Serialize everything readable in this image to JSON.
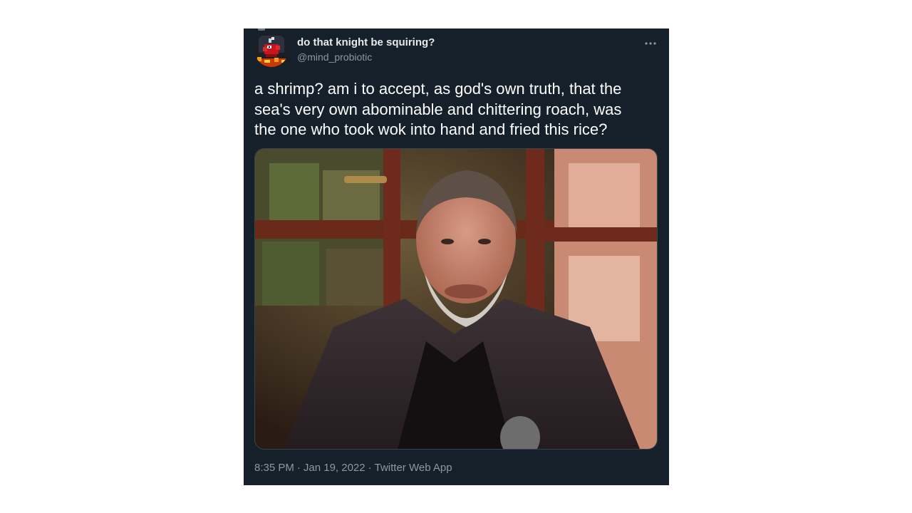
{
  "tweet": {
    "author": {
      "display_name": "do that knight be squiring?",
      "handle": "@mind_probiotic",
      "avatar_icon": "pixel-knight-avatar"
    },
    "more_icon": "more-dots-icon",
    "text": "a shrimp? am i to accept, as god's own truth, that the\nsea's very own abominable and chittering roach, was\nthe one who took wok into hand and fried this rice?",
    "media": {
      "kind": "photo"
    },
    "meta": {
      "time": "8:35 PM",
      "separator": "·",
      "date": "Jan 19, 2022",
      "source": "Twitter Web App"
    }
  },
  "colors": {
    "card_background": "#15202b",
    "primary_text": "#ffffff",
    "secondary_text": "#8b98a5",
    "media_border": "#38444d"
  }
}
